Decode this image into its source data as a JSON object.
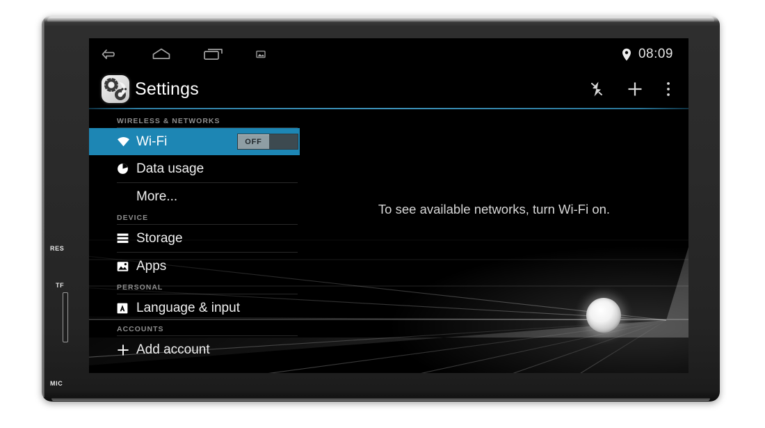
{
  "device": {
    "type": "car-head-unit",
    "bezel_labels": [
      {
        "name": "reset",
        "text": "RES"
      },
      {
        "name": "tf-card-slot",
        "text": "TF"
      },
      {
        "name": "microphone",
        "text": "MIC"
      }
    ]
  },
  "statusbar": {
    "nav_icons": [
      "back-icon",
      "home-icon",
      "recents-icon",
      "screenshot-icon"
    ],
    "location_icon": "location-pin-icon",
    "clock": "08:09"
  },
  "actionbar": {
    "app_icon": "settings-gear-icon",
    "title": "Settings",
    "icons": [
      "sync-icon",
      "add-icon",
      "overflow-menu-icon"
    ],
    "divider_color": "#3d93bb"
  },
  "colors": {
    "accent_blue": "#1d86b4",
    "screen_bg": "#000000",
    "text_primary": "#f0f0f0",
    "section_header": "#8e8e8e"
  },
  "settings_list": {
    "sections": [
      {
        "header": "WIRELESS & NETWORKS",
        "items": [
          {
            "label": "Wi-Fi",
            "icon": "wifi-icon",
            "selected": true,
            "toggle": {
              "state": "OFF",
              "checked": false
            }
          },
          {
            "label": "Data usage",
            "icon": "data-usage-icon",
            "selected": false
          },
          {
            "label": "More...",
            "icon": null,
            "selected": false
          }
        ]
      },
      {
        "header": "DEVICE",
        "items": [
          {
            "label": "Storage",
            "icon": "storage-icon",
            "selected": false
          },
          {
            "label": "Apps",
            "icon": "apps-icon",
            "selected": false
          }
        ]
      },
      {
        "header": "PERSONAL",
        "items": [
          {
            "label": "Language & input",
            "icon": "language-input-icon",
            "selected": false
          }
        ]
      },
      {
        "header": "ACCOUNTS",
        "items": [
          {
            "label": "Add account",
            "icon": "plus-icon",
            "selected": false
          }
        ]
      }
    ]
  },
  "detail_panel": {
    "message": "To see available networks, turn Wi-Fi on."
  },
  "hardware": {
    "knob": "volume-power-knob"
  }
}
